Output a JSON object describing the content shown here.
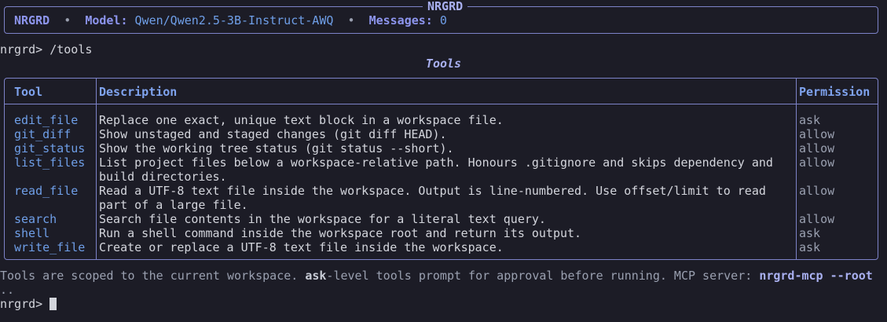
{
  "header": {
    "title": "NRGRD",
    "app": "NRGRD",
    "model_label": "Model:",
    "model_value": "Qwen/Qwen2.5-3B-Instruct-AWQ",
    "messages_label": "Messages:",
    "messages_value": "0",
    "separator": "•"
  },
  "prompt": {
    "first": "nrgrd> /tools",
    "last": "nrgrd> "
  },
  "table": {
    "caption": "Tools",
    "headers": {
      "tool": "Tool",
      "description": "Description",
      "permission": "Permission"
    },
    "rows": [
      {
        "tool": "edit_file",
        "description": [
          "Replace one exact, unique text block in a workspace file."
        ],
        "permission": "ask"
      },
      {
        "tool": "git_diff",
        "description": [
          "Show unstaged and staged changes (git diff HEAD)."
        ],
        "permission": "allow"
      },
      {
        "tool": "git_status",
        "description": [
          "Show the working tree status (git status --short)."
        ],
        "permission": "allow"
      },
      {
        "tool": "list_files",
        "description": [
          "List project files below a workspace-relative path. Honours .gitignore and skips dependency and",
          "build directories."
        ],
        "permission": "allow"
      },
      {
        "tool": "read_file",
        "description": [
          "Read a UTF-8 text file inside the workspace. Output is line-numbered. Use offset/limit to read",
          "part of a large file."
        ],
        "permission": "allow"
      },
      {
        "tool": "search",
        "description": [
          "Search file contents in the workspace for a literal text query."
        ],
        "permission": "allow"
      },
      {
        "tool": "shell",
        "description": [
          "Run a shell command inside the workspace root and return its output."
        ],
        "permission": "ask"
      },
      {
        "tool": "write_file",
        "description": [
          "Create or replace a UTF-8 text file inside the workspace."
        ],
        "permission": "ask"
      }
    ]
  },
  "footer": {
    "part1": "Tools are scoped to the current workspace. ",
    "ask": "ask",
    "part2": "-level tools prompt for approval before running. MCP server: ",
    "cmd": "nrgrd-mcp --root",
    "wrap": ".."
  }
}
